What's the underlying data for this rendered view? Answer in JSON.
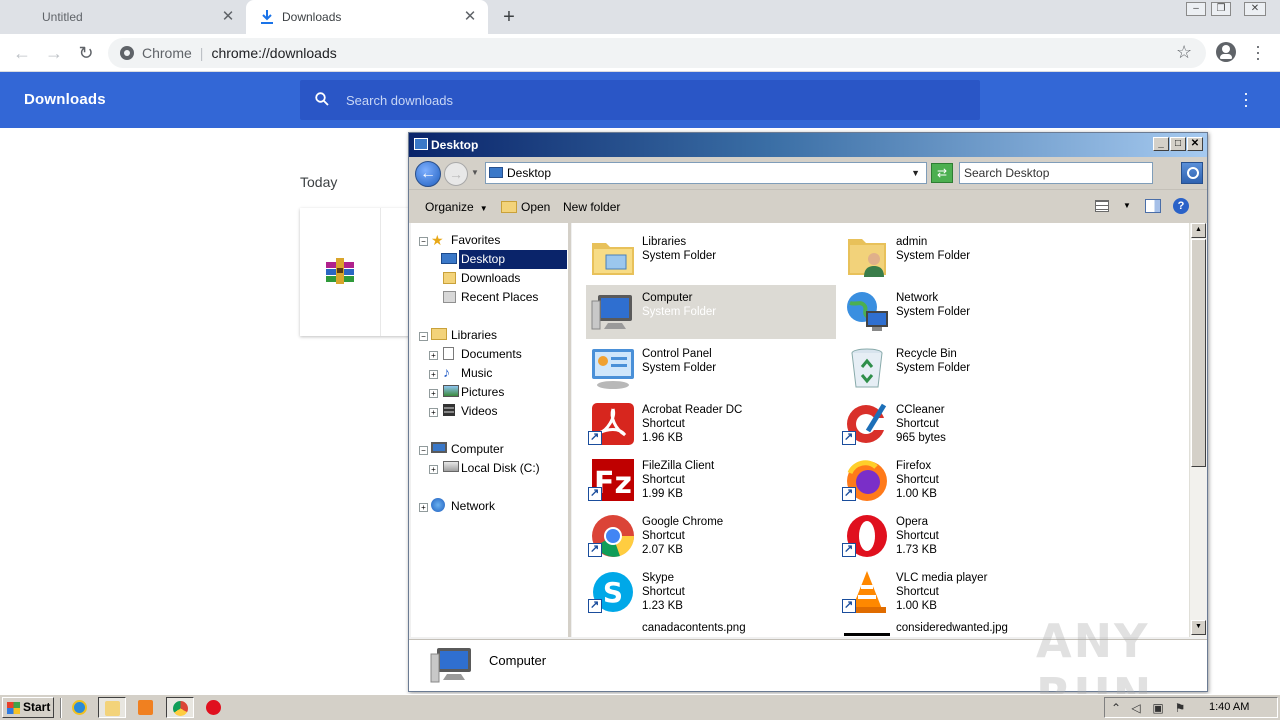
{
  "browser": {
    "tabs": [
      {
        "label": "Untitled",
        "active": false
      },
      {
        "label": "Downloads",
        "active": true
      }
    ],
    "omnibox": {
      "scheme_label": "Chrome",
      "url": "chrome://downloads"
    }
  },
  "downloads_page": {
    "title": "Downloads",
    "search_placeholder": "Search downloads",
    "section_label": "Today",
    "header_color": "#3367d6"
  },
  "explorer": {
    "title": "Desktop",
    "address": "Desktop",
    "search_placeholder": "Search Desktop",
    "commands": {
      "organize": "Organize",
      "open": "Open",
      "new_folder": "New folder"
    },
    "nav": {
      "favorites": "Favorites",
      "desktop": "Desktop",
      "downloads": "Downloads",
      "recent_places": "Recent Places",
      "libraries": "Libraries",
      "documents": "Documents",
      "music": "Music",
      "pictures": "Pictures",
      "videos": "Videos",
      "computer": "Computer",
      "local_disk": "Local Disk (C:)",
      "network": "Network"
    },
    "items": [
      {
        "name": "Libraries",
        "type": "System Folder",
        "size": "",
        "icon": "libraries-icon"
      },
      {
        "name": "admin",
        "type": "System Folder",
        "size": "",
        "icon": "user-folder-icon"
      },
      {
        "name": "Computer",
        "type": "System Folder",
        "size": "",
        "icon": "computer-icon",
        "selected": true
      },
      {
        "name": "Network",
        "type": "System Folder",
        "size": "",
        "icon": "network-icon"
      },
      {
        "name": "Control Panel",
        "type": "System Folder",
        "size": "",
        "icon": "control-panel-icon"
      },
      {
        "name": "Recycle Bin",
        "type": "System Folder",
        "size": "",
        "icon": "recycle-bin-icon"
      },
      {
        "name": "Acrobat Reader DC",
        "type": "Shortcut",
        "size": "1.96 KB",
        "icon": "acrobat-icon"
      },
      {
        "name": "CCleaner",
        "type": "Shortcut",
        "size": "965 bytes",
        "icon": "ccleaner-icon"
      },
      {
        "name": "FileZilla Client",
        "type": "Shortcut",
        "size": "1.99 KB",
        "icon": "filezilla-icon"
      },
      {
        "name": "Firefox",
        "type": "Shortcut",
        "size": "1.00 KB",
        "icon": "firefox-icon"
      },
      {
        "name": "Google Chrome",
        "type": "Shortcut",
        "size": "2.07 KB",
        "icon": "chrome-icon"
      },
      {
        "name": "Opera",
        "type": "Shortcut",
        "size": "1.73 KB",
        "icon": "opera-icon"
      },
      {
        "name": "Skype",
        "type": "Shortcut",
        "size": "1.23 KB",
        "icon": "skype-icon"
      },
      {
        "name": "VLC media player",
        "type": "Shortcut",
        "size": "1.00 KB",
        "icon": "vlc-icon"
      },
      {
        "name": "canadacontents.png",
        "type": "",
        "size": "",
        "icon": "image-file-icon"
      },
      {
        "name": "consideredwanted.jpg",
        "type": "",
        "size": "",
        "icon": "image-file-icon"
      }
    ],
    "details": {
      "name": "Computer"
    }
  },
  "taskbar": {
    "start_label": "Start",
    "clock": "1:40 AM"
  },
  "watermark": "ANY RUN"
}
